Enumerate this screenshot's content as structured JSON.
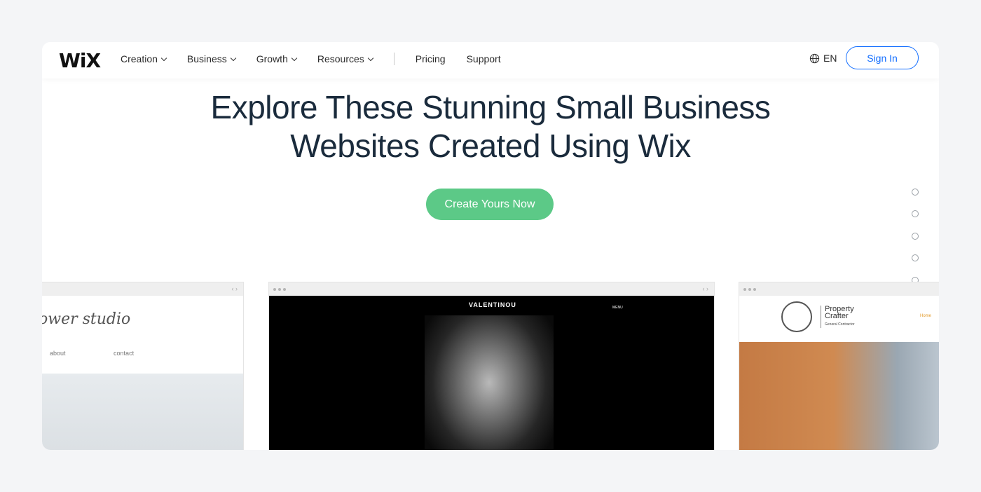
{
  "nav": {
    "logo": "WiX",
    "items": [
      {
        "label": "Creation",
        "has_dropdown": true
      },
      {
        "label": "Business",
        "has_dropdown": true
      },
      {
        "label": "Growth",
        "has_dropdown": true
      },
      {
        "label": "Resources",
        "has_dropdown": true
      }
    ],
    "pricing": "Pricing",
    "support": "Support",
    "language": "EN",
    "signin": "Sign In"
  },
  "hero": {
    "line1": "Explore These Stunning Small Business",
    "line2": "Websites Created Using Wix",
    "cta": "Create Yours Now"
  },
  "slider": {
    "total": 7,
    "active_index": 5
  },
  "showcase": {
    "left": {
      "title": "ower studio",
      "links": [
        "about",
        "contact"
      ]
    },
    "center": {
      "brand": "VALENTINOU",
      "menu": "MENU"
    },
    "right": {
      "name_line1": "Property",
      "name_line2": "Crafter",
      "subtitle": "General Contractor",
      "nav_item": "Home"
    }
  },
  "colors": {
    "accent": "#116dff",
    "cta": "#5cc987",
    "heading": "#1a2b3c",
    "background": "#f4f5f7"
  }
}
